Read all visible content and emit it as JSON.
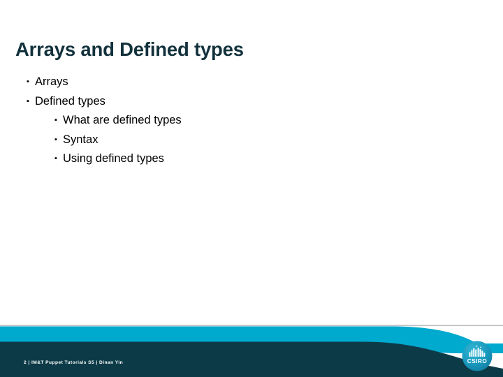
{
  "slide": {
    "title": "Arrays and Defined types",
    "bullets": [
      {
        "level": 1,
        "marker": "▪",
        "text": "Arrays"
      },
      {
        "level": 1,
        "marker": "▪",
        "text": "Defined types"
      },
      {
        "level": 2,
        "marker": "▪",
        "text": "What are defined types"
      },
      {
        "level": 2,
        "marker": "▪",
        "text": "Syntax"
      },
      {
        "level": 2,
        "marker": "▪",
        "text": "Using defined types"
      }
    ]
  },
  "footer": {
    "slide_number": "2",
    "separator": "|",
    "deck_title": "IM&T Puppet Tutorials S5",
    "presenter": "Dinan Yin",
    "full_text": "2  |  IM&T Puppet Tutorials S5  |  Dinan Yin"
  },
  "logo": {
    "wordmark": "CSIRO"
  },
  "colors": {
    "title": "#12313C",
    "body_text": "#000000",
    "band_cyan": "#00A9CE",
    "band_navy": "#0C3B47",
    "divider_gray": "#B8BEC2",
    "logo_teal": "#1996B8",
    "background": "#FFFFFF"
  }
}
